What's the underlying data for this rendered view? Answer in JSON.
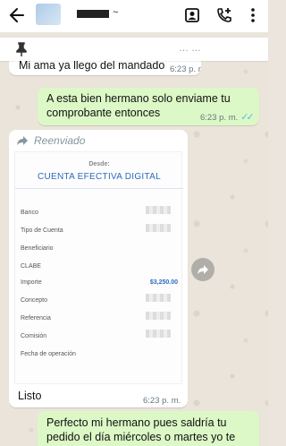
{
  "header": {
    "contact_name_tail": "~  ¹¹",
    "icons": [
      "back-arrow-icon",
      "contact-card-icon",
      "add-call-icon",
      "more-vert-icon"
    ]
  },
  "pinned": {
    "icon": "pin-icon",
    "faded_text": "… …"
  },
  "messages": [
    {
      "direction": "in",
      "text": "Mi ama ya llego del mandado",
      "time": "6:23 p. m."
    },
    {
      "direction": "out",
      "text": "A esta bien hermano solo enviame tu comprobante entonces",
      "time": "6:23 p. m.",
      "status": "read"
    },
    {
      "direction": "in",
      "forwarded_label": "Reenviado",
      "receipt": {
        "desde_label": "Desde:",
        "account_name": "CUENTA EFECTIVA DIGITAL",
        "rows": [
          {
            "label": "Banco",
            "value": ""
          },
          {
            "label": "Tipo de Cuenta",
            "value": ""
          },
          {
            "label": "Beneficiario",
            "value": ""
          },
          {
            "label": "CLABE",
            "value": ""
          },
          {
            "label": "Importe",
            "value": "$3,250.00"
          },
          {
            "label": "Concepto",
            "value": ""
          },
          {
            "label": "Referencia",
            "value": ""
          },
          {
            "label": "Comisión",
            "value": ""
          },
          {
            "label": "Fecha de operación",
            "value": ""
          }
        ]
      },
      "caption": "Listo",
      "time": "6:23 p. m."
    },
    {
      "direction": "out",
      "text": "Perfecto mi hermano pues saldría tu pedido el día miércoles o martes yo te"
    }
  ],
  "colors": {
    "outgoing_bubble": "#dcf8c6",
    "incoming_bubble": "#ffffff",
    "read_ticks": "#53bdeb",
    "chat_background": "#ebe4da"
  }
}
